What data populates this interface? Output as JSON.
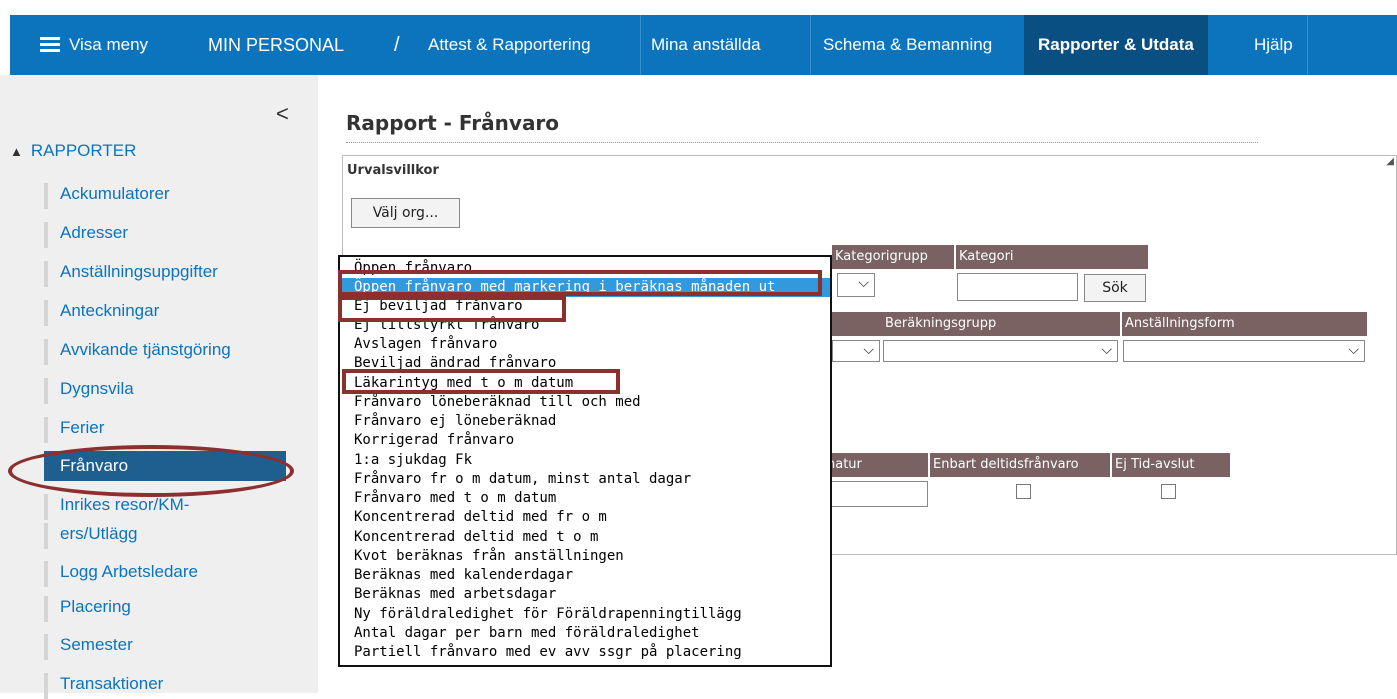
{
  "nav": {
    "menu_label": "Visa meny",
    "brand": "MIN PERSONAL",
    "slash": "/",
    "items": [
      "Attest & Rapportering",
      "Mina anställda",
      "Schema & Bemanning",
      "Rapporter & Utdata",
      "Hjälp"
    ],
    "active_index": 3
  },
  "sidebar": {
    "collapse_glyph": "<",
    "section_title": "RAPPORTER",
    "items": [
      "Ackumulatorer",
      "Adresser",
      "Anställningsuppgifter",
      "Anteckningar",
      "Avvikande tjänstgöring",
      "Dygnsvila",
      "Ferier",
      "Frånvaro",
      "Inrikes resor/KM-",
      "ers/Utlägg",
      "Logg Arbetsledare",
      "Placering",
      "Semester",
      "Transaktioner"
    ],
    "active_item": "Frånvaro"
  },
  "main": {
    "title": "Rapport - Frånvaro",
    "panel_title": "Urvalsvillkor",
    "choose_org_button": "Välj org...",
    "search_button": "Sök",
    "headers": {
      "kategorigrupp": "Kategorigrupp",
      "kategori": "Kategori",
      "berakningsgrupp": "Beräkningsgrupp",
      "anstallningsform": "Anställningsform",
      "natur": "natur",
      "deltid": "Enbart deltidsfrånvaro",
      "ejtid": "Ej Tid-avslut"
    }
  },
  "dropdown": {
    "options": [
      "Öppen frånvaro",
      "Öppen frånvaro med markering i beräknas månaden ut",
      "Ej beviljad frånvaro",
      "Ej tillstyrkt frånvaro",
      "Avslagen frånvaro",
      "Beviljad ändrad frånvaro",
      "Läkarintyg med t o m datum",
      "Frånvaro löneberäknad till och med",
      "Frånvaro ej löneberäknad",
      "Korrigerad frånvaro",
      "1:a sjukdag Fk",
      "Frånvaro fr o m datum, minst antal dagar",
      "Frånvaro med t o m datum",
      "Koncentrerad deltid med fr o m",
      "Koncentrerad deltid med t o m",
      "Kvot beräknas från anställningen",
      "Beräknas med kalenderdagar",
      "Beräknas med arbetsdagar",
      "Ny föräldraledighet för Föräldrapenningtillägg",
      "Antal dagar per barn med föräldraledighet",
      "Partiell frånvaro med ev avv ssgr på placering"
    ],
    "selected": "Öppen frånvaro med markering i beräknas månaden ut",
    "highlighted": [
      "Öppen frånvaro med markering i beräknas månaden ut",
      "Ej beviljad frånvaro",
      "Läkarintyg med t o m datum"
    ]
  },
  "colors": {
    "nav": "#0b74bd",
    "nav_active": "#0a4f82",
    "header_brown": "#7a6262",
    "annotation": "#8c2f2f",
    "selection": "#3399dd"
  }
}
